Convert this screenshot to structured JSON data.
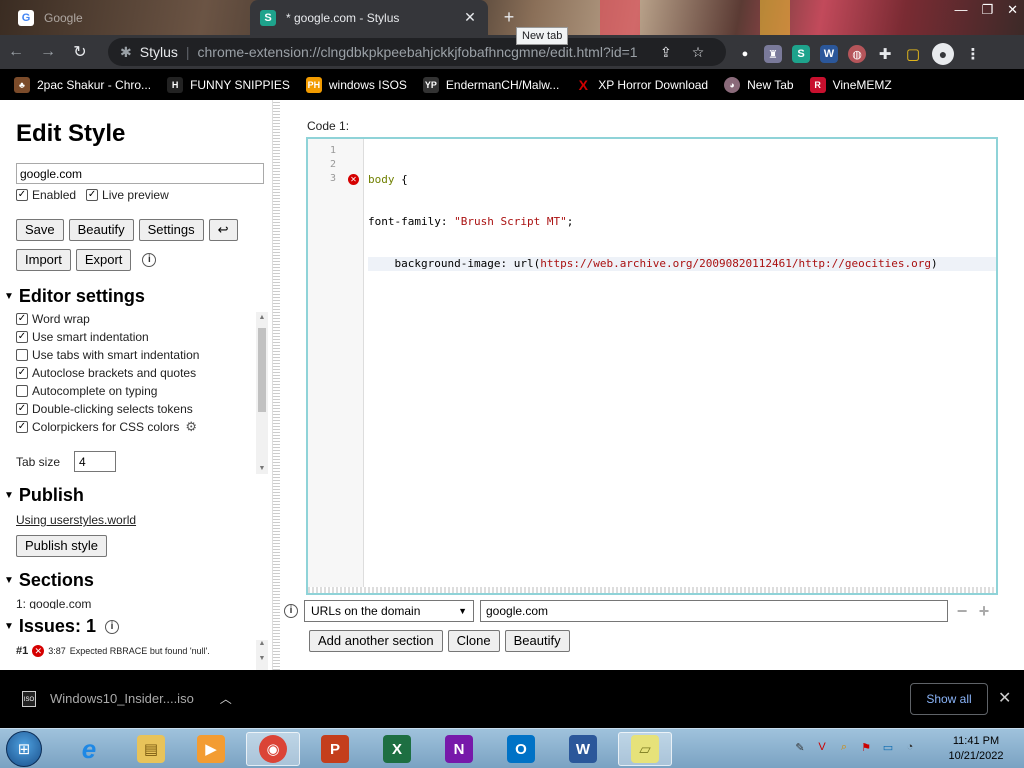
{
  "browser": {
    "tabs": [
      {
        "title": "Google",
        "favicon": "G",
        "active": false
      },
      {
        "title": "* google.com - Stylus",
        "favicon": "S",
        "active": true
      }
    ],
    "new_tab_tooltip": "New tab",
    "address": {
      "site": "Stylus",
      "url": "chrome-extension://clngdbkpkpeebahjckkjfobafhncgmne/edit.html?id=1"
    },
    "bookmarks": [
      {
        "label": "2pac Shakur - Chro...",
        "icon": "bookmark-icon-2pac",
        "color": "#7b4b2a"
      },
      {
        "label": "FUNNY SNIPPIES",
        "icon": "H",
        "color": "#222222"
      },
      {
        "label": "windows ISOS",
        "icon": "PH",
        "color": "#f29b00"
      },
      {
        "label": "EndermanCH/Malw...",
        "icon": "YP",
        "color": "#333333"
      },
      {
        "label": "XP Horror Download",
        "icon": "X",
        "color": "#d00000"
      },
      {
        "label": "New Tab",
        "icon": "new-tab-icon",
        "color": "#8a6a7a"
      },
      {
        "label": "VineMEMZ",
        "icon": "R",
        "color": "#c8102e"
      }
    ]
  },
  "editor": {
    "title": "Edit Style",
    "style_name": "google.com",
    "enabled_label": "Enabled",
    "live_preview_label": "Live preview",
    "buttons": {
      "save": "Save",
      "beautify": "Beautify",
      "settings": "Settings",
      "undo": "↩",
      "import": "Import",
      "export": "Export"
    },
    "editor_settings": {
      "heading": "Editor settings",
      "options": [
        {
          "label": "Word wrap",
          "checked": true
        },
        {
          "label": "Use smart indentation",
          "checked": true
        },
        {
          "label": "Use tabs with smart indentation",
          "checked": false
        },
        {
          "label": "Autoclose brackets and quotes",
          "checked": true
        },
        {
          "label": "Autocomplete on typing",
          "checked": false
        },
        {
          "label": "Double-clicking selects tokens",
          "checked": true
        },
        {
          "label": "Colorpickers for CSS colors",
          "checked": true
        }
      ],
      "tab_size_label": "Tab size",
      "tab_size_value": "4"
    },
    "publish": {
      "heading": "Publish",
      "link": "Using userstyles.world",
      "button": "Publish style"
    },
    "sections": {
      "heading": "Sections",
      "items": [
        "1: google.com"
      ]
    },
    "issues": {
      "heading": "Issues: 1",
      "items": [
        {
          "num": "#1",
          "pos": "3:87",
          "message": "Expected RBRACE but found 'null'."
        }
      ]
    },
    "code_label": "Code 1:",
    "code": {
      "line_numbers": [
        "1",
        "2",
        "3"
      ],
      "line1": {
        "selector": "body",
        "brace": " {"
      },
      "line2": {
        "property": "font-family",
        "colon": ": ",
        "value": "\"Brush Script MT\"",
        "semi": ";"
      },
      "line3": {
        "indent": "    ",
        "property": "background-image",
        "colon": ": ",
        "fn": "url(",
        "url": "https://web.archive.org/20090820112461/http://geocities.org",
        "close": ")"
      }
    },
    "applies": {
      "type": "URLs on the domain",
      "value": "google.com"
    },
    "section_buttons": {
      "add": "Add another section",
      "clone": "Clone",
      "beautify": "Beautify"
    }
  },
  "downloads": {
    "file": "Windows10_Insider....iso",
    "show_all": "Show all"
  },
  "taskbar": {
    "apps": [
      {
        "name": "ie-icon",
        "glyph": "e",
        "color": "#1e88e5"
      },
      {
        "name": "explorer-icon",
        "glyph": "▤",
        "color": "#e8c35a"
      },
      {
        "name": "media-player-icon",
        "glyph": "▶",
        "color": "#f39c32"
      },
      {
        "name": "chrome-icon",
        "glyph": "◉",
        "color": "#db4437"
      },
      {
        "name": "powerpoint-icon",
        "glyph": "P",
        "color": "#c43e1c"
      },
      {
        "name": "excel-icon",
        "glyph": "X",
        "color": "#1d6f42"
      },
      {
        "name": "onenote-icon",
        "glyph": "N",
        "color": "#7719aa"
      },
      {
        "name": "outlook-icon",
        "glyph": "O",
        "color": "#0072c6"
      },
      {
        "name": "word-icon",
        "glyph": "W",
        "color": "#2b579a"
      },
      {
        "name": "sticky-notes-icon",
        "glyph": "▱",
        "color": "#e6e27a"
      }
    ],
    "time": "11:41 PM",
    "date": "10/21/2022"
  }
}
